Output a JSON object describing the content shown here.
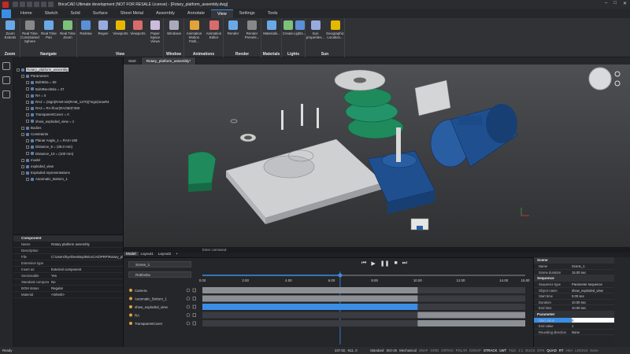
{
  "window": {
    "title": "BricsCAD Ultimate development (NOT FOR RESALE License) - [Rotary_platform_assembly.dwg]"
  },
  "ribbon_tabs": [
    "Home",
    "Sketch",
    "Solid",
    "Surface",
    "Sheet Metal",
    "Assembly",
    "Annotate",
    "View",
    "Settings",
    "Tools"
  ],
  "ribbon_active": "View",
  "ribbon_groups": [
    {
      "label": "Zoom",
      "buttons": [
        "Zoom Extents"
      ]
    },
    {
      "label": "Navigate",
      "buttons": [
        "Real Time Constrained Sphere",
        "Real Time Pan",
        "Real Time Zoom"
      ]
    },
    {
      "label": "View",
      "buttons": [
        "Redraw",
        "Regen",
        "Viewports",
        "Viewports",
        "Paper Space Views"
      ]
    },
    {
      "label": "Window",
      "buttons": [
        "Windows"
      ]
    },
    {
      "label": "Animations",
      "buttons": [
        "Animation Motion Path...",
        "Animation Editor"
      ]
    },
    {
      "label": "Render",
      "buttons": [
        "Render",
        "Render Presets..."
      ]
    },
    {
      "label": "Materials",
      "buttons": [
        "Materials..."
      ]
    },
    {
      "label": "Lights",
      "buttons": [
        "Create",
        "Lights..."
      ]
    },
    {
      "label": "Sun",
      "buttons": [
        "Sun properties...",
        "Geographic Location..."
      ]
    }
  ],
  "doc_tabs": [
    "Start",
    "Rotary_platform_assembly*"
  ],
  "tree": [
    {
      "label": "Rotary_platform_assembly",
      "level": 0,
      "selected": true
    },
    {
      "label": "Parameters",
      "level": 1
    },
    {
      "label": "BoltIIDia = 60",
      "level": 2
    },
    {
      "label": "BoltIINeckDia = 27",
      "level": 2
    },
    {
      "label": "RA = 0",
      "level": 2
    },
    {
      "label": "RA2 = (Sign(RAM-sin(RAM_1270))*sign(maxR4",
      "level": 2
    },
    {
      "label": "RA3 = RA-floor(RA/360)*360",
      "level": 2
    },
    {
      "label": "TransparentCover = 0",
      "level": 2
    },
    {
      "label": "show_exploded_view = 1",
      "level": 2
    },
    {
      "label": "Bodies",
      "level": 1
    },
    {
      "label": "Constraints",
      "level": 1
    },
    {
      "label": "Planar Angle_1 = RA2+180",
      "level": 2
    },
    {
      "label": "Distance_9 = (38.0 mm)",
      "level": 2
    },
    {
      "label": "Distance_10 = (100 mm)",
      "level": 2
    },
    {
      "label": "model",
      "level": 1
    },
    {
      "label": "exploded_view",
      "level": 1
    },
    {
      "label": "Exploded representations",
      "level": 1
    },
    {
      "label": "Automatic_Bottom_1",
      "level": 2
    }
  ],
  "props": {
    "header": "Component",
    "rows": [
      {
        "k": "Name",
        "v": "Rotary platform assembly"
      },
      {
        "k": "Description",
        "v": ""
      },
      {
        "k": "File",
        "v": "C:\\Users\\hye\\Desktop\\BricsCAD\\PRP\\Rotary_platf"
      },
      {
        "k": "Extension type",
        "v": ""
      },
      {
        "k": "Insert as",
        "v": "External component"
      },
      {
        "k": "Sectionable",
        "v": "Yes"
      },
      {
        "k": "Standard component",
        "v": "No"
      },
      {
        "k": "BOM status",
        "v": "Regular"
      },
      {
        "k": "Material",
        "v": "<Inherit>"
      }
    ]
  },
  "cmd": {
    "prompt": "Enter command"
  },
  "layout_tabs": [
    "Model",
    "Layout1",
    "Layout2",
    "+"
  ],
  "anim": {
    "scene_select": "Scene_1",
    "rotate_select": "RotDxDa",
    "render_button": "Render video",
    "time_ticks": [
      "0.00",
      "2.00",
      "4.00",
      "6.00",
      "8.00",
      "10.00",
      "12.00",
      "14.00",
      "15.00"
    ],
    "duration": 15,
    "playhead": 6.4,
    "tracks": [
      {
        "name": "Camera",
        "start": 0,
        "end": 10,
        "kind": "grey",
        "color": "#e0a43b"
      },
      {
        "name": "Automatic_Bottom_1",
        "start": 0,
        "end": 10,
        "kind": "grey",
        "color": "#e0a43b"
      },
      {
        "name": "show_exploded_view",
        "start": 0,
        "end": 10,
        "kind": "blue",
        "color": "#e0a43b"
      },
      {
        "name": "RA",
        "start": 10,
        "end": 15,
        "kind": "grey",
        "color": "#e0a43b"
      },
      {
        "name": "TransparentCover",
        "start": 10,
        "end": 15,
        "kind": "grey",
        "color": "#e0a43b"
      }
    ]
  },
  "scene": {
    "sections": [
      {
        "title": "Scene",
        "rows": [
          {
            "k": "Name",
            "v": "Scene_1"
          },
          {
            "k": "Scene duration",
            "v": "15.00 sec"
          }
        ]
      },
      {
        "title": "Sequence",
        "rows": [
          {
            "k": "Sequence type",
            "v": "Parameter sequence"
          },
          {
            "k": "Object name",
            "v": "show_exploded_view"
          },
          {
            "k": "Start time",
            "v": "0.00 sec"
          },
          {
            "k": "Duration",
            "v": "10.00 sec"
          },
          {
            "k": "End time",
            "v": "10.00 sec"
          }
        ]
      },
      {
        "title": "Parameter",
        "rows": [
          {
            "k": "Start value",
            "v": "0"
          },
          {
            "k": "End value",
            "v": "1"
          },
          {
            "k": "Rounding direction",
            "v": "None"
          }
        ]
      }
    ]
  },
  "status": {
    "left": "Ready",
    "coords": "237.82, -611, 0",
    "items": [
      "Standard",
      "ISO-25",
      "Mechanical",
      "SNAP",
      "GRID",
      "ORTHO",
      "POLAR",
      "ESNAP",
      "STRACK",
      "LWT",
      "TILE",
      "1:1",
      "DUCS",
      "DYN",
      "QUAD",
      "RT",
      "HKA",
      "LOCKUI",
      "None"
    ]
  },
  "colors": {
    "accent": "#3a8ee6",
    "green": "#1f8a5b",
    "blue": "#1f4f8f",
    "track_blue": "#3a8ee6"
  }
}
